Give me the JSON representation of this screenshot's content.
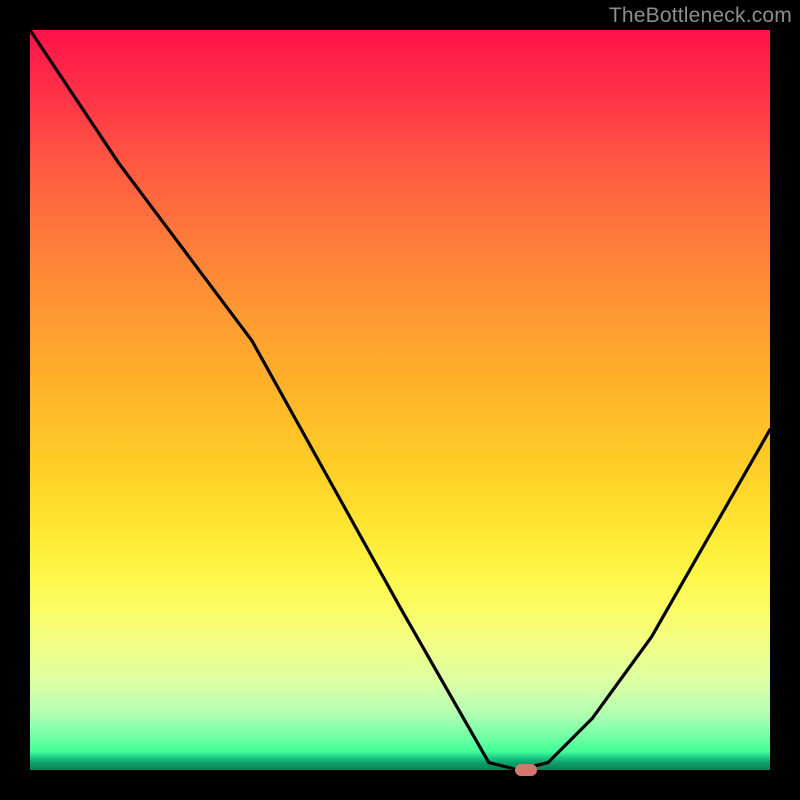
{
  "watermark": "TheBottleneck.com",
  "marker_color": "#d5776e",
  "chart_data": {
    "type": "line",
    "title": "",
    "xlabel": "",
    "ylabel": "",
    "xlim": [
      0,
      100
    ],
    "ylim": [
      0,
      100
    ],
    "grid": false,
    "legend": false,
    "curve": [
      {
        "x": 0,
        "y": 100
      },
      {
        "x": 12,
        "y": 82
      },
      {
        "x": 24,
        "y": 66
      },
      {
        "x": 30,
        "y": 58
      },
      {
        "x": 40,
        "y": 40
      },
      {
        "x": 50,
        "y": 22
      },
      {
        "x": 58,
        "y": 8
      },
      {
        "x": 62,
        "y": 1
      },
      {
        "x": 66,
        "y": 0
      },
      {
        "x": 70,
        "y": 1
      },
      {
        "x": 76,
        "y": 7
      },
      {
        "x": 84,
        "y": 18
      },
      {
        "x": 92,
        "y": 32
      },
      {
        "x": 100,
        "y": 46
      }
    ],
    "optimum": {
      "x": 67,
      "y": 0
    }
  }
}
